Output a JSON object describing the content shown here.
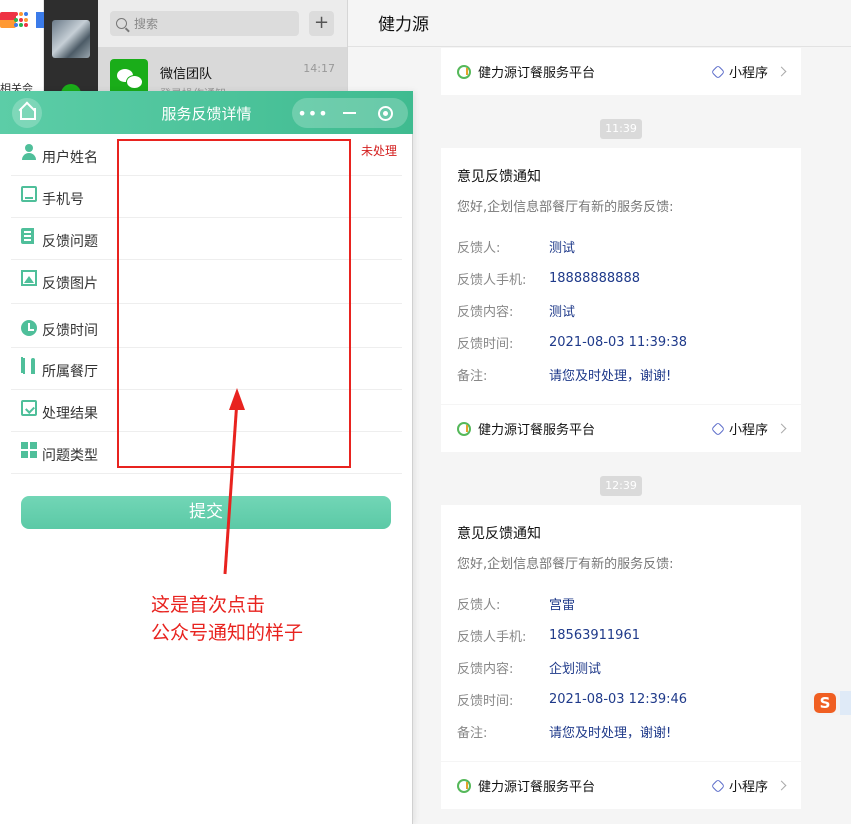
{
  "desktop": {
    "partial_text": "相关会"
  },
  "wechat": {
    "search_placeholder": "搜索",
    "add_label": "+",
    "chat_item": {
      "name": "微信团队",
      "time": "14:17",
      "preview": "登录操作通知"
    }
  },
  "conversation": {
    "title": "健力源",
    "platform_name": "健力源订餐服务平台",
    "mini_program_label": "小程序",
    "messages": [
      {
        "time": "11:39",
        "title": "意见反馈通知",
        "subtitle": "您好,企划信息部餐厅有新的服务反馈:",
        "fields": [
          {
            "key": "反馈人:",
            "value": "测试"
          },
          {
            "key": "反馈人手机:",
            "value": "18888888888"
          },
          {
            "key": "反馈内容:",
            "value": "测试"
          },
          {
            "key": "反馈时间:",
            "value": "2021-08-03 11:39:38"
          },
          {
            "key": "备注:",
            "value": "请您及时处理，谢谢!"
          }
        ]
      },
      {
        "time": "12:39",
        "title": "意见反馈通知",
        "subtitle": "您好,企划信息部餐厅有新的服务反馈:",
        "fields": [
          {
            "key": "反馈人:",
            "value": "宫雷"
          },
          {
            "key": "反馈人手机:",
            "value": "18563911961"
          },
          {
            "key": "反馈内容:",
            "value": "企划测试"
          },
          {
            "key": "反馈时间:",
            "value": "2021-08-03 12:39:46"
          },
          {
            "key": "备注:",
            "value": "请您及时处理，谢谢!"
          }
        ]
      }
    ]
  },
  "mini_program": {
    "title": "服务反馈详情",
    "more_label": "•••",
    "status": "未处理",
    "fields": [
      {
        "label": "用户姓名",
        "icon": "user-icon"
      },
      {
        "label": "手机号",
        "icon": "phone-icon"
      },
      {
        "label": "反馈问题",
        "icon": "document-icon"
      },
      {
        "label": "反馈图片",
        "icon": "image-icon"
      },
      {
        "label": "反馈时间",
        "icon": "clock-icon"
      },
      {
        "label": "所属餐厅",
        "icon": "fork-knife-icon"
      },
      {
        "label": "处理结果",
        "icon": "clipboard-icon"
      },
      {
        "label": "问题类型",
        "icon": "grid-icon"
      }
    ],
    "submit_label": "提交"
  },
  "annotation": {
    "line1": "这是首次点击",
    "line2": "公众号通知的样子",
    "color": "#e8231f"
  },
  "ime": {
    "label": "S"
  },
  "colors": {
    "mini_bar": "#4cc49c",
    "chat_bg": "#f5f5f5",
    "link": "#1f3a8a"
  }
}
